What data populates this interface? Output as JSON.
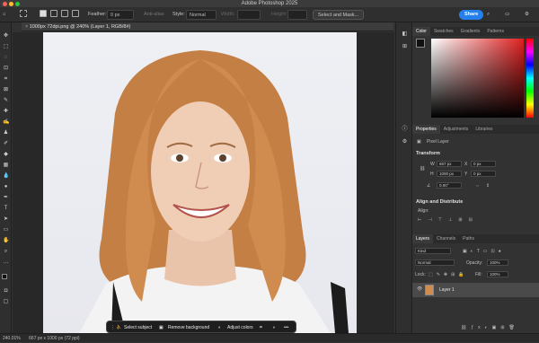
{
  "app": {
    "title": "Adobe Photoshop 2025"
  },
  "options": {
    "feather_label": "Feather:",
    "feather_value": "0 px",
    "antialias_label": "Anti-alias",
    "style_label": "Style:",
    "style_value": "Normal",
    "width_label": "Width:",
    "height_label": "Height:",
    "select_mask_label": "Select and Mask...",
    "share_label": "Share"
  },
  "document": {
    "tab_title": "1000px 72dpi.png @ 240% (Layer 1, RGB/8#)"
  },
  "color_panel": {
    "tabs": [
      "Color",
      "Swatches",
      "Gradients",
      "Patterns"
    ],
    "hue": "#e02020"
  },
  "properties_panel": {
    "tabs": [
      "Properties",
      "Adjustments",
      "Libraries"
    ],
    "layer_type": "Pixel Layer",
    "transform_title": "Transform",
    "w_label": "W",
    "w_value": "667 px",
    "h_label": "H",
    "h_value": "1000 px",
    "x_label": "X",
    "x_value": "0 px",
    "y_label": "Y",
    "y_value": "0 px",
    "angle_value": "0.00°",
    "align_title": "Align and Distribute",
    "align_label": "Align:"
  },
  "layers_panel": {
    "tabs": [
      "Layers",
      "Channels",
      "Paths"
    ],
    "filter_value": "Kind",
    "blend_mode": "Normal",
    "opacity_label": "Opacity:",
    "opacity_value": "100%",
    "lock_label": "Lock:",
    "fill_label": "Fill:",
    "fill_value": "100%",
    "layers": [
      {
        "name": "Layer 1"
      }
    ]
  },
  "taskbar": {
    "select_subject": "Select subject",
    "remove_background": "Remove background",
    "adjust_colors": "Adjust colors"
  },
  "status": {
    "zoom": "240.01%",
    "info": "667 px x 1000 px (72 ppi)"
  }
}
